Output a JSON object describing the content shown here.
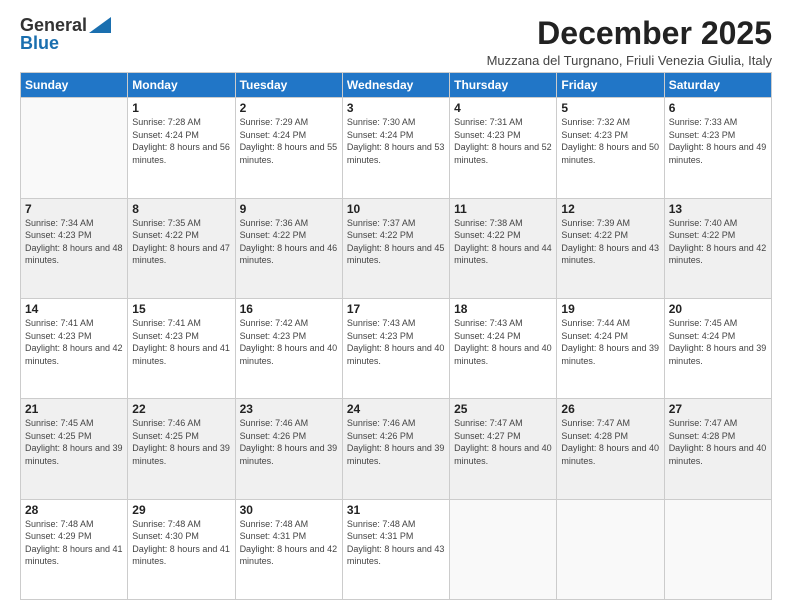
{
  "logo": {
    "general": "General",
    "blue": "Blue"
  },
  "title": "December 2025",
  "location": "Muzzana del Turgnano, Friuli Venezia Giulia, Italy",
  "days_of_week": [
    "Sunday",
    "Monday",
    "Tuesday",
    "Wednesday",
    "Thursday",
    "Friday",
    "Saturday"
  ],
  "weeks": [
    [
      {
        "day": "",
        "sunrise": "",
        "sunset": "",
        "daylight": ""
      },
      {
        "day": "1",
        "sunrise": "Sunrise: 7:28 AM",
        "sunset": "Sunset: 4:24 PM",
        "daylight": "Daylight: 8 hours and 56 minutes."
      },
      {
        "day": "2",
        "sunrise": "Sunrise: 7:29 AM",
        "sunset": "Sunset: 4:24 PM",
        "daylight": "Daylight: 8 hours and 55 minutes."
      },
      {
        "day": "3",
        "sunrise": "Sunrise: 7:30 AM",
        "sunset": "Sunset: 4:24 PM",
        "daylight": "Daylight: 8 hours and 53 minutes."
      },
      {
        "day": "4",
        "sunrise": "Sunrise: 7:31 AM",
        "sunset": "Sunset: 4:23 PM",
        "daylight": "Daylight: 8 hours and 52 minutes."
      },
      {
        "day": "5",
        "sunrise": "Sunrise: 7:32 AM",
        "sunset": "Sunset: 4:23 PM",
        "daylight": "Daylight: 8 hours and 50 minutes."
      },
      {
        "day": "6",
        "sunrise": "Sunrise: 7:33 AM",
        "sunset": "Sunset: 4:23 PM",
        "daylight": "Daylight: 8 hours and 49 minutes."
      }
    ],
    [
      {
        "day": "7",
        "sunrise": "Sunrise: 7:34 AM",
        "sunset": "Sunset: 4:23 PM",
        "daylight": "Daylight: 8 hours and 48 minutes."
      },
      {
        "day": "8",
        "sunrise": "Sunrise: 7:35 AM",
        "sunset": "Sunset: 4:22 PM",
        "daylight": "Daylight: 8 hours and 47 minutes."
      },
      {
        "day": "9",
        "sunrise": "Sunrise: 7:36 AM",
        "sunset": "Sunset: 4:22 PM",
        "daylight": "Daylight: 8 hours and 46 minutes."
      },
      {
        "day": "10",
        "sunrise": "Sunrise: 7:37 AM",
        "sunset": "Sunset: 4:22 PM",
        "daylight": "Daylight: 8 hours and 45 minutes."
      },
      {
        "day": "11",
        "sunrise": "Sunrise: 7:38 AM",
        "sunset": "Sunset: 4:22 PM",
        "daylight": "Daylight: 8 hours and 44 minutes."
      },
      {
        "day": "12",
        "sunrise": "Sunrise: 7:39 AM",
        "sunset": "Sunset: 4:22 PM",
        "daylight": "Daylight: 8 hours and 43 minutes."
      },
      {
        "day": "13",
        "sunrise": "Sunrise: 7:40 AM",
        "sunset": "Sunset: 4:22 PM",
        "daylight": "Daylight: 8 hours and 42 minutes."
      }
    ],
    [
      {
        "day": "14",
        "sunrise": "Sunrise: 7:41 AM",
        "sunset": "Sunset: 4:23 PM",
        "daylight": "Daylight: 8 hours and 42 minutes."
      },
      {
        "day": "15",
        "sunrise": "Sunrise: 7:41 AM",
        "sunset": "Sunset: 4:23 PM",
        "daylight": "Daylight: 8 hours and 41 minutes."
      },
      {
        "day": "16",
        "sunrise": "Sunrise: 7:42 AM",
        "sunset": "Sunset: 4:23 PM",
        "daylight": "Daylight: 8 hours and 40 minutes."
      },
      {
        "day": "17",
        "sunrise": "Sunrise: 7:43 AM",
        "sunset": "Sunset: 4:23 PM",
        "daylight": "Daylight: 8 hours and 40 minutes."
      },
      {
        "day": "18",
        "sunrise": "Sunrise: 7:43 AM",
        "sunset": "Sunset: 4:24 PM",
        "daylight": "Daylight: 8 hours and 40 minutes."
      },
      {
        "day": "19",
        "sunrise": "Sunrise: 7:44 AM",
        "sunset": "Sunset: 4:24 PM",
        "daylight": "Daylight: 8 hours and 39 minutes."
      },
      {
        "day": "20",
        "sunrise": "Sunrise: 7:45 AM",
        "sunset": "Sunset: 4:24 PM",
        "daylight": "Daylight: 8 hours and 39 minutes."
      }
    ],
    [
      {
        "day": "21",
        "sunrise": "Sunrise: 7:45 AM",
        "sunset": "Sunset: 4:25 PM",
        "daylight": "Daylight: 8 hours and 39 minutes."
      },
      {
        "day": "22",
        "sunrise": "Sunrise: 7:46 AM",
        "sunset": "Sunset: 4:25 PM",
        "daylight": "Daylight: 8 hours and 39 minutes."
      },
      {
        "day": "23",
        "sunrise": "Sunrise: 7:46 AM",
        "sunset": "Sunset: 4:26 PM",
        "daylight": "Daylight: 8 hours and 39 minutes."
      },
      {
        "day": "24",
        "sunrise": "Sunrise: 7:46 AM",
        "sunset": "Sunset: 4:26 PM",
        "daylight": "Daylight: 8 hours and 39 minutes."
      },
      {
        "day": "25",
        "sunrise": "Sunrise: 7:47 AM",
        "sunset": "Sunset: 4:27 PM",
        "daylight": "Daylight: 8 hours and 40 minutes."
      },
      {
        "day": "26",
        "sunrise": "Sunrise: 7:47 AM",
        "sunset": "Sunset: 4:28 PM",
        "daylight": "Daylight: 8 hours and 40 minutes."
      },
      {
        "day": "27",
        "sunrise": "Sunrise: 7:47 AM",
        "sunset": "Sunset: 4:28 PM",
        "daylight": "Daylight: 8 hours and 40 minutes."
      }
    ],
    [
      {
        "day": "28",
        "sunrise": "Sunrise: 7:48 AM",
        "sunset": "Sunset: 4:29 PM",
        "daylight": "Daylight: 8 hours and 41 minutes."
      },
      {
        "day": "29",
        "sunrise": "Sunrise: 7:48 AM",
        "sunset": "Sunset: 4:30 PM",
        "daylight": "Daylight: 8 hours and 41 minutes."
      },
      {
        "day": "30",
        "sunrise": "Sunrise: 7:48 AM",
        "sunset": "Sunset: 4:31 PM",
        "daylight": "Daylight: 8 hours and 42 minutes."
      },
      {
        "day": "31",
        "sunrise": "Sunrise: 7:48 AM",
        "sunset": "Sunset: 4:31 PM",
        "daylight": "Daylight: 8 hours and 43 minutes."
      },
      {
        "day": "",
        "sunrise": "",
        "sunset": "",
        "daylight": ""
      },
      {
        "day": "",
        "sunrise": "",
        "sunset": "",
        "daylight": ""
      },
      {
        "day": "",
        "sunrise": "",
        "sunset": "",
        "daylight": ""
      }
    ]
  ]
}
